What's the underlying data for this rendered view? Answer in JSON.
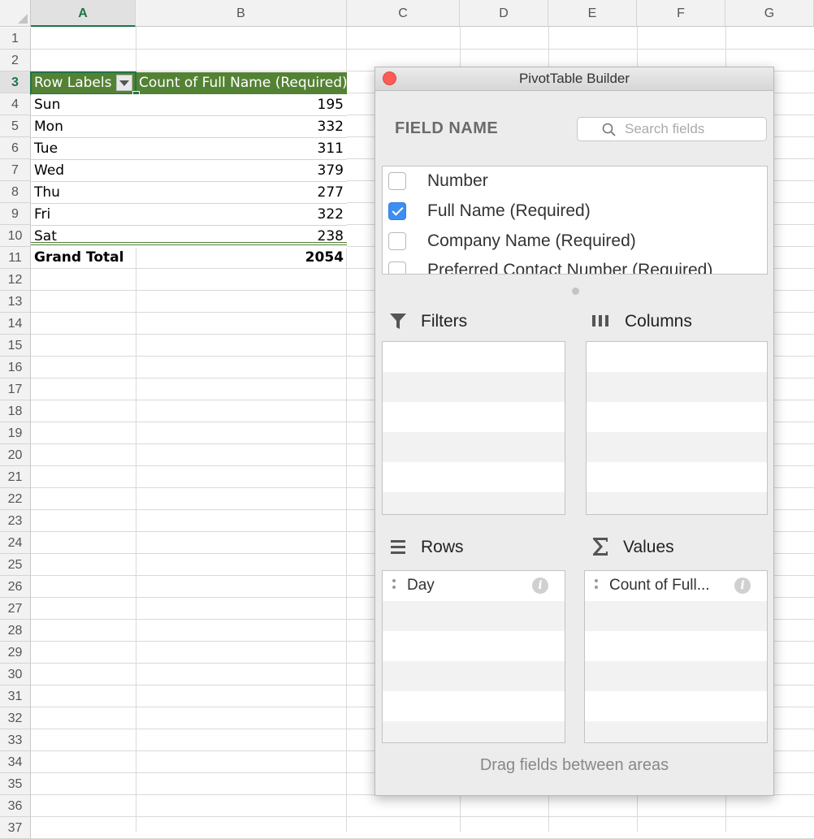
{
  "sheet": {
    "columns": [
      "A",
      "B",
      "C",
      "D",
      "E",
      "F",
      "G"
    ],
    "rows": [
      "1",
      "2",
      "3",
      "4",
      "5",
      "6",
      "7",
      "8",
      "9",
      "10",
      "11",
      "12",
      "13",
      "14",
      "15",
      "16",
      "17",
      "18",
      "19",
      "20",
      "21",
      "22",
      "23",
      "24",
      "25",
      "26",
      "27",
      "28",
      "29",
      "30",
      "31",
      "32",
      "33",
      "34",
      "35",
      "36",
      "37"
    ],
    "active_column": "A",
    "active_row": "3"
  },
  "pivot_table": {
    "header_label": "Row Labels",
    "header_value": "Count of Full Name (Required)",
    "rows": [
      {
        "label": "Sun",
        "value": "195"
      },
      {
        "label": "Mon",
        "value": "332"
      },
      {
        "label": "Tue",
        "value": "311"
      },
      {
        "label": "Wed",
        "value": "379"
      },
      {
        "label": "Thu",
        "value": "277"
      },
      {
        "label": "Fri",
        "value": "322"
      },
      {
        "label": "Sat",
        "value": "238"
      }
    ],
    "total_label": "Grand Total",
    "total_value": "2054"
  },
  "builder": {
    "title": "PivotTable Builder",
    "field_name_heading": "FIELD NAME",
    "search_placeholder": "Search fields",
    "fields": [
      {
        "label": "Number",
        "checked": false
      },
      {
        "label": "Full Name (Required)",
        "checked": true
      },
      {
        "label": "Company Name (Required)",
        "checked": false
      },
      {
        "label": "Preferred Contact Number (Required)",
        "checked": false
      }
    ],
    "areas": {
      "filters": {
        "label": "Filters",
        "icon": "filter-icon",
        "items": []
      },
      "columns": {
        "label": "Columns",
        "icon": "columns-icon",
        "items": []
      },
      "rows": {
        "label": "Rows",
        "icon": "rows-icon",
        "items": [
          "Day"
        ]
      },
      "values": {
        "label": "Values",
        "icon": "sigma-icon",
        "items": [
          "Count of Full..."
        ]
      }
    },
    "footer": "Drag fields between areas"
  },
  "colors": {
    "pivot_header": "#548235",
    "excel_green": "#217346",
    "checkbox_blue": "#3d8ef2",
    "close_red": "#fc5b57"
  }
}
